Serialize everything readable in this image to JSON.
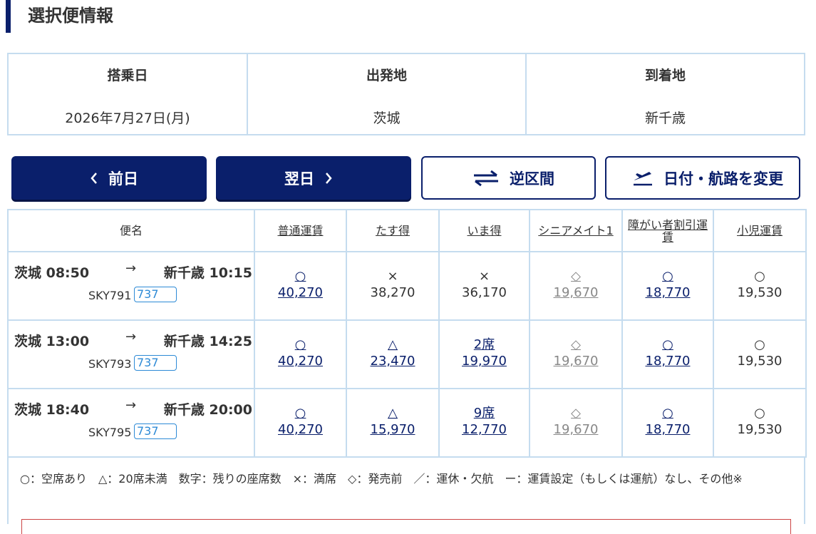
{
  "section_title": "選択便情報",
  "info": {
    "date_label": "搭乗日",
    "date_value": "2026年7月27日(月)",
    "origin_label": "出発地",
    "origin_value": "茨城",
    "dest_label": "到着地",
    "dest_value": "新千歳"
  },
  "buttons": {
    "prev": "前日",
    "next": "翌日",
    "reverse": "逆区間",
    "change": "日付・航路を変更"
  },
  "table": {
    "headers": [
      "便名",
      "普通運賃",
      "たす得",
      "いま得",
      "シニアメイト1",
      "障がい者割引運賃",
      "小児運賃"
    ],
    "flights": [
      {
        "dep": "茨城 08:50",
        "arrow": "→",
        "arr": "新千歳 10:15",
        "flight_no": "SKY791",
        "aircraft": "737",
        "fares": [
          {
            "sym": "○",
            "price": "40,270",
            "style": "link"
          },
          {
            "sym": "×",
            "price": "38,270",
            "style": "plain"
          },
          {
            "sym": "×",
            "price": "36,170",
            "style": "plain"
          },
          {
            "sym": "◇",
            "price": "19,670",
            "style": "grey"
          },
          {
            "sym": "○",
            "price": "18,770",
            "style": "link"
          },
          {
            "sym": "○",
            "price": "19,530",
            "style": "plain"
          }
        ]
      },
      {
        "dep": "茨城 13:00",
        "arrow": "→",
        "arr": "新千歳 14:25",
        "flight_no": "SKY793",
        "aircraft": "737",
        "fares": [
          {
            "sym": "○",
            "price": "40,270",
            "style": "link"
          },
          {
            "sym": "△",
            "price": "23,470",
            "style": "link"
          },
          {
            "sym": "2席",
            "price": "19,970",
            "style": "link"
          },
          {
            "sym": "◇",
            "price": "19,670",
            "style": "grey"
          },
          {
            "sym": "○",
            "price": "18,770",
            "style": "link"
          },
          {
            "sym": "○",
            "price": "19,530",
            "style": "plain"
          }
        ]
      },
      {
        "dep": "茨城 18:40",
        "arrow": "→",
        "arr": "新千歳 20:00",
        "flight_no": "SKY795",
        "aircraft": "737",
        "fares": [
          {
            "sym": "○",
            "price": "40,270",
            "style": "link"
          },
          {
            "sym": "△",
            "price": "15,970",
            "style": "link"
          },
          {
            "sym": "9席",
            "price": "12,770",
            "style": "link"
          },
          {
            "sym": "◇",
            "price": "19,670",
            "style": "grey"
          },
          {
            "sym": "○",
            "price": "18,770",
            "style": "link"
          },
          {
            "sym": "○",
            "price": "19,530",
            "style": "plain"
          }
        ]
      }
    ]
  },
  "legend": "○：空席あり　△：20席未満　数字：残りの座席数　×：満席　◇：発売前　／：運休・欠航　ー：運賃設定（もしくは運航）なし、その他※",
  "colors": {
    "navy": "#0a1f6b",
    "border": "#c5dcef",
    "aircraft_badge": "#2d8ad6"
  }
}
